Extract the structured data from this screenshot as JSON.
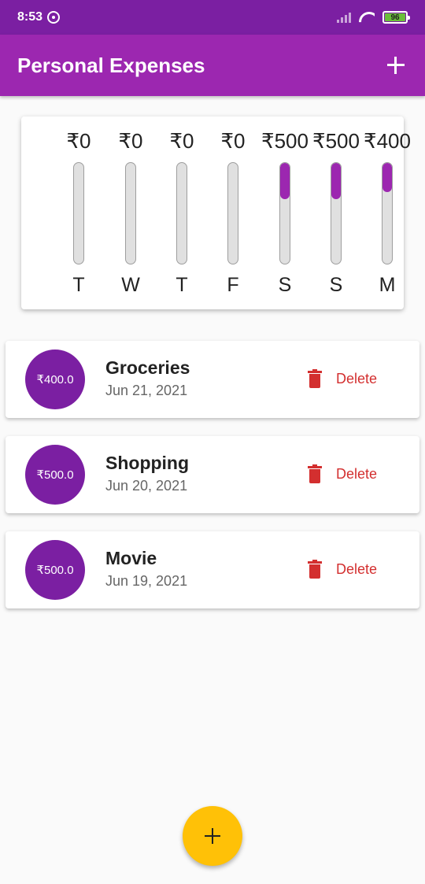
{
  "status_bar": {
    "time": "8:53",
    "battery": "96",
    "icons": [
      "music-app-icon",
      "signal-icon",
      "wifi-icon",
      "battery-icon"
    ]
  },
  "app_bar": {
    "title": "Personal Expenses",
    "add_icon": "plus-icon"
  },
  "chart": {
    "bars": [
      {
        "day": "T",
        "amount": "₹0",
        "fraction": 0
      },
      {
        "day": "W",
        "amount": "₹0",
        "fraction": 0
      },
      {
        "day": "T",
        "amount": "₹0",
        "fraction": 0
      },
      {
        "day": "F",
        "amount": "₹0",
        "fraction": 0
      },
      {
        "day": "S",
        "amount": "₹500",
        "fraction": 0.357
      },
      {
        "day": "S",
        "amount": "₹500",
        "fraction": 0.357
      },
      {
        "day": "M",
        "amount": "₹400",
        "fraction": 0.286
      }
    ]
  },
  "transactions": [
    {
      "amount": "₹400.0",
      "title": "Groceries",
      "date": "Jun 21, 2021",
      "delete_label": "Delete"
    },
    {
      "amount": "₹500.0",
      "title": "Shopping",
      "date": "Jun 20, 2021",
      "delete_label": "Delete"
    },
    {
      "amount": "₹500.0",
      "title": "Movie",
      "date": "Jun 19, 2021",
      "delete_label": "Delete"
    }
  ],
  "fab": {
    "icon": "plus-icon"
  },
  "colors": {
    "primary": "#9c27b0",
    "primary_dark": "#7b1fa2",
    "accent": "#ffc107",
    "delete": "#d32f2f"
  }
}
